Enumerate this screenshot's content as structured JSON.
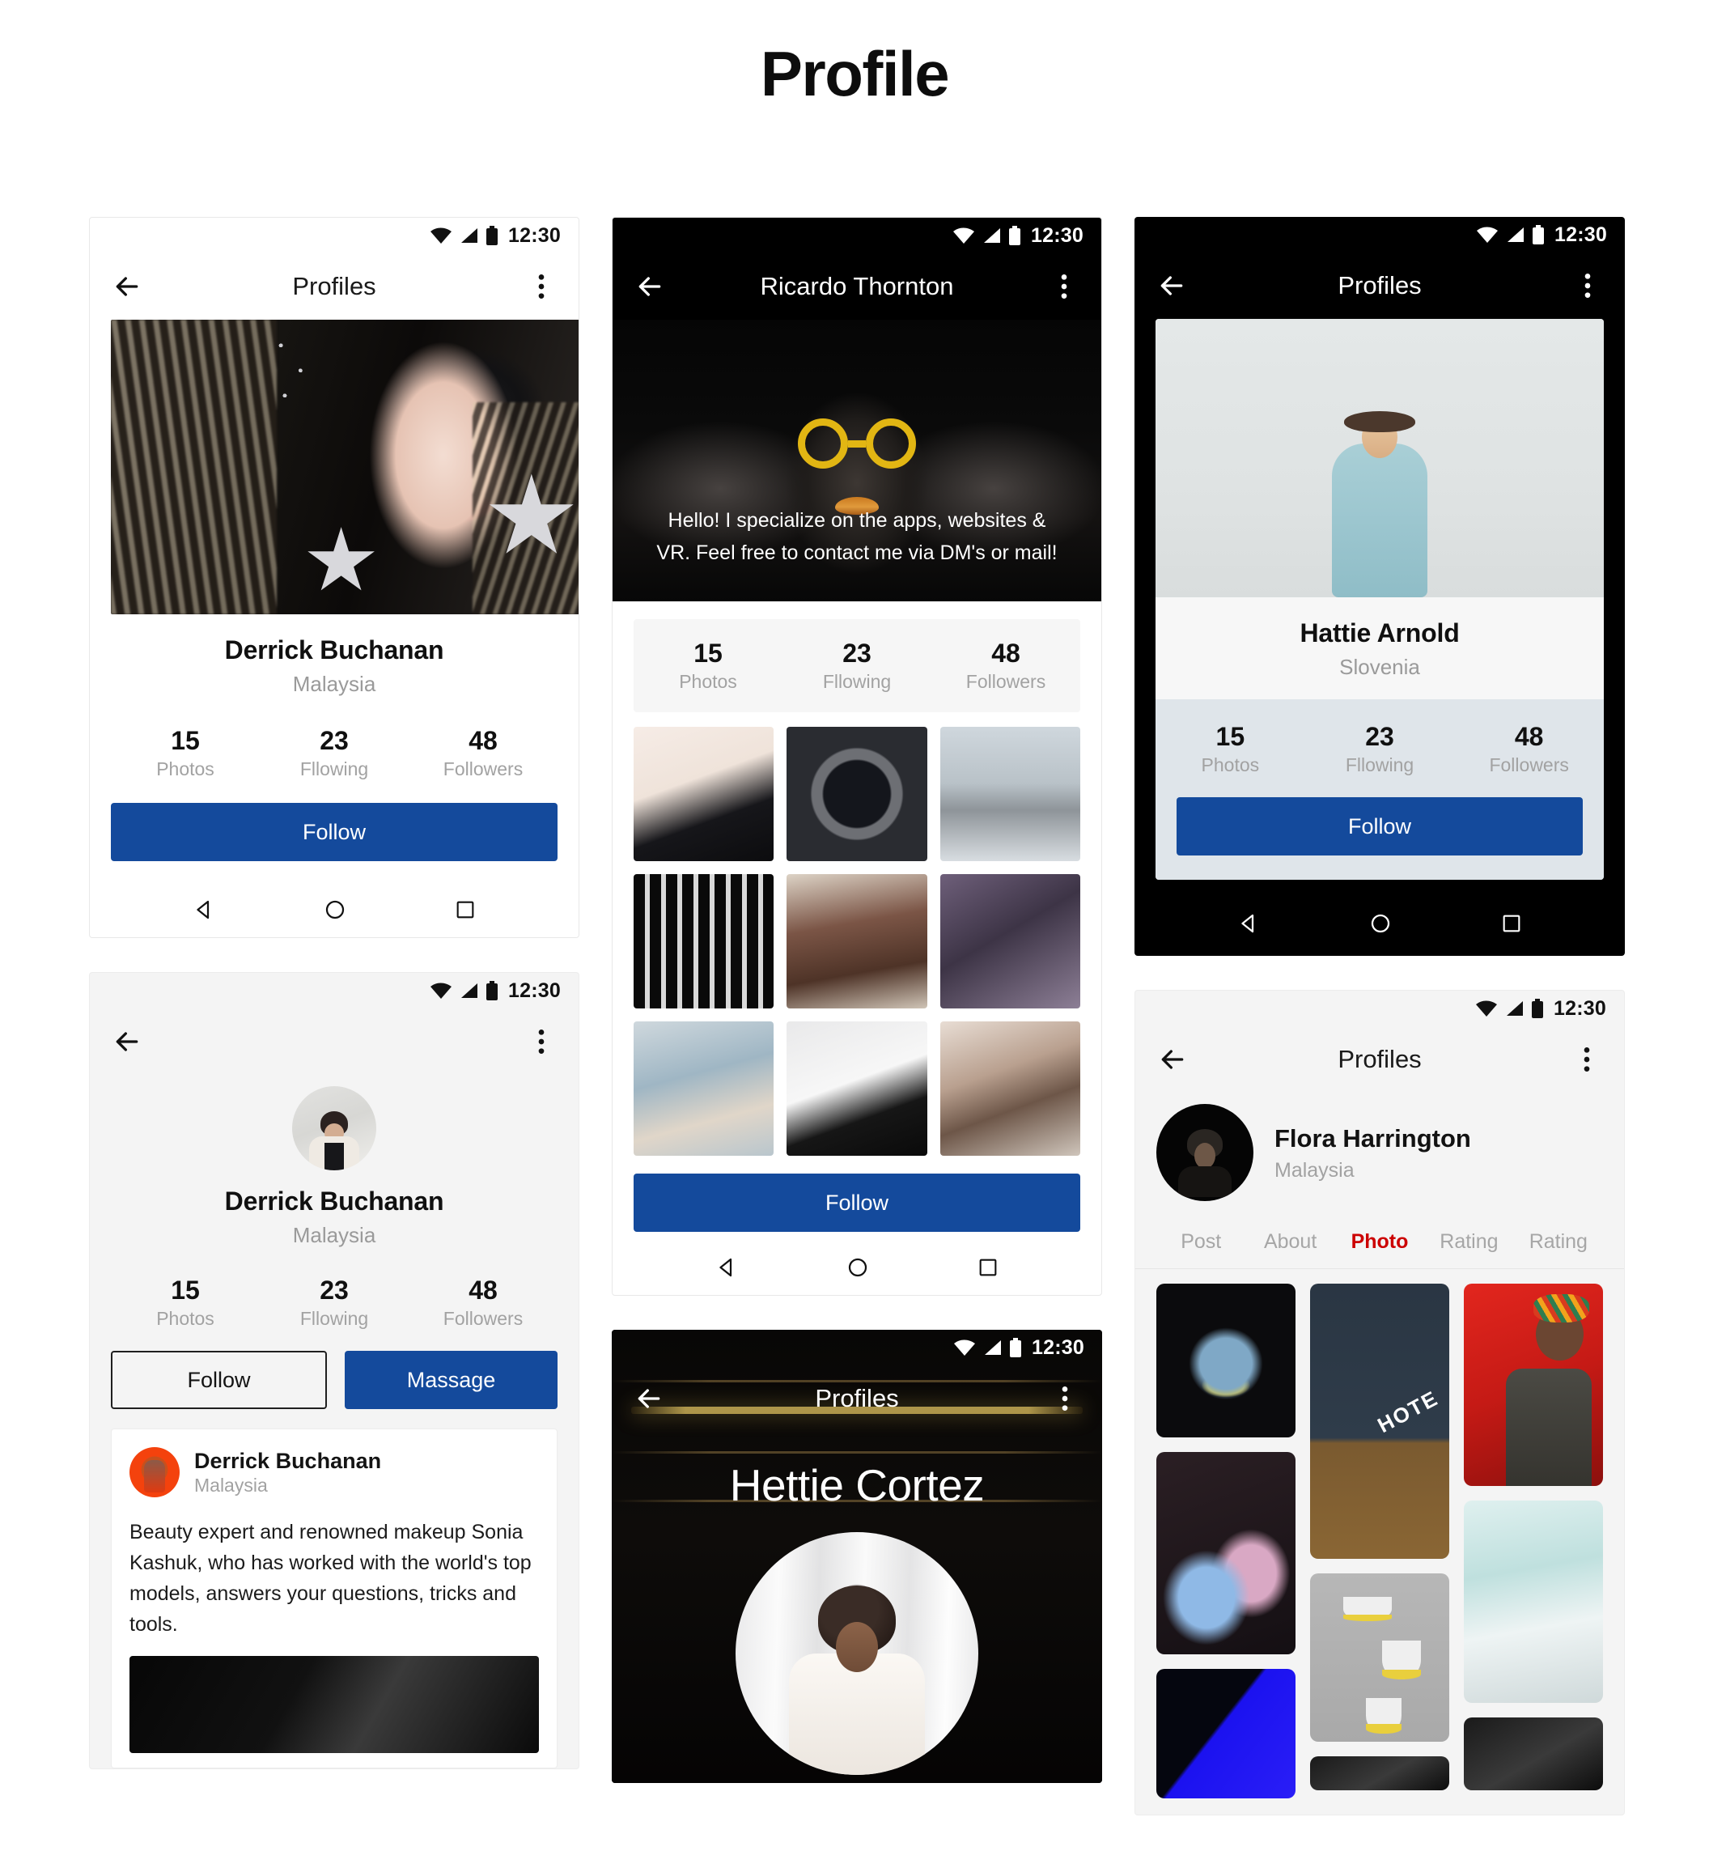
{
  "page": {
    "title": "Profile"
  },
  "status_bar": {
    "time": "12:30",
    "wifi": "wifi-icon",
    "signal": "signal-icon",
    "battery": "battery-icon"
  },
  "common": {
    "back": "back-arrow-icon",
    "more": "more-vertical-icon",
    "nav_back": "nav-back-icon",
    "nav_home": "nav-home-icon",
    "nav_recents": "nav-recents-icon"
  },
  "colors": {
    "primary_blue": "#144a9c",
    "accent_red": "#cc0000",
    "muted_text": "#a2a2a2",
    "stats_band": "#dfe5ea"
  },
  "screens": {
    "derrick_hero": {
      "appbar_title": "Profiles",
      "name": "Derrick Buchanan",
      "location": "Malaysia",
      "stats": [
        {
          "value": "15",
          "label": "Photos"
        },
        {
          "value": "23",
          "label": "Fllowing"
        },
        {
          "value": "48",
          "label": "Followers"
        }
      ],
      "follow_button": "Follow"
    },
    "derrick_feed": {
      "name": "Derrick Buchanan",
      "location": "Malaysia",
      "stats": [
        {
          "value": "15",
          "label": "Photos"
        },
        {
          "value": "23",
          "label": "Fllowing"
        },
        {
          "value": "48",
          "label": "Followers"
        }
      ],
      "follow_button": "Follow",
      "message_button": "Massage",
      "post": {
        "author": "Derrick Buchanan",
        "location": "Malaysia",
        "text": "Beauty expert and renowned makeup Sonia Kashuk, who has worked with the world's top models, answers your questions, tricks and tools."
      }
    },
    "ricardo": {
      "appbar_title": "Ricardo Thornton",
      "bio": "Hello! I specialize on the apps, websites & VR. Feel free to contact me via DM's or mail!",
      "stats": [
        {
          "value": "15",
          "label": "Photos"
        },
        {
          "value": "23",
          "label": "Fllowing"
        },
        {
          "value": "48",
          "label": "Followers"
        }
      ],
      "follow_button": "Follow",
      "gallery": [
        "photo-shirt",
        "photo-watch",
        "photo-crosswalk",
        "photo-windows",
        "photo-coat",
        "photo-branches",
        "photo-poolside",
        "photo-notebook",
        "photo-bag"
      ]
    },
    "hattie": {
      "appbar_title": "Profiles",
      "name": "Hattie Arnold",
      "location": "Slovenia",
      "stats": [
        {
          "value": "15",
          "label": "Photos"
        },
        {
          "value": "23",
          "label": "Fllowing"
        },
        {
          "value": "48",
          "label": "Followers"
        }
      ],
      "follow_button": "Follow"
    },
    "hettie_cortez": {
      "appbar_title": "Profiles",
      "name": "Hettie Cortez"
    },
    "flora": {
      "appbar_title": "Profiles",
      "name": "Flora Harrington",
      "location": "Malaysia",
      "tabs": [
        {
          "label": "Post",
          "active": false
        },
        {
          "label": "About",
          "active": false
        },
        {
          "label": "Photo",
          "active": true
        },
        {
          "label": "Rating",
          "active": false
        },
        {
          "label": "Rating",
          "active": false
        }
      ],
      "gallery": [
        "photo-blue-chair",
        "photo-pods",
        "photo-blue-diagonal",
        "photo-hotel",
        "photo-pendant-lamps",
        "photo-red-portrait",
        "photo-atrium",
        "photo-dark-bag"
      ]
    }
  }
}
